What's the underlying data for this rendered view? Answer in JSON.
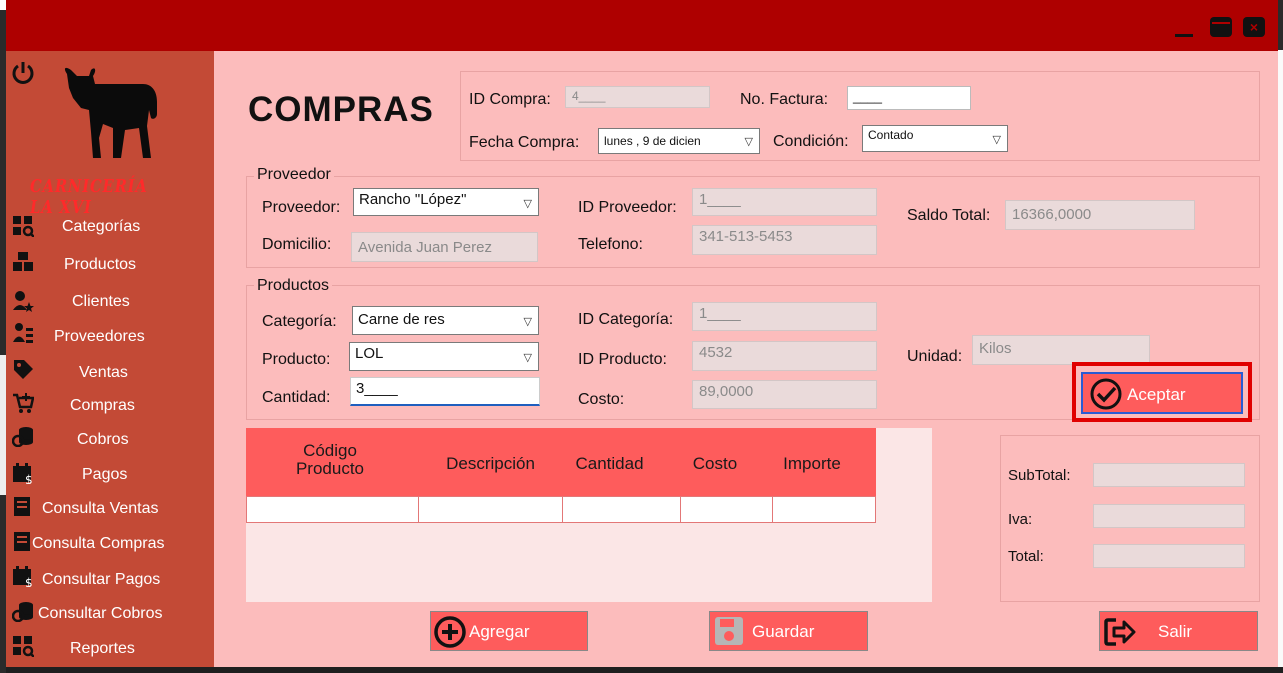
{
  "sidebar": {
    "brand": "CARNICERÍA LA XVI",
    "items": [
      {
        "label": "Categorías",
        "icon": "categories-icon"
      },
      {
        "label": "Productos",
        "icon": "boxes-icon"
      },
      {
        "label": "Clientes",
        "icon": "client-star-icon"
      },
      {
        "label": "Proveedores",
        "icon": "supplier-icon"
      },
      {
        "label": "Ventas",
        "icon": "tag-icon"
      },
      {
        "label": "Compras",
        "icon": "cart-plus-icon"
      },
      {
        "label": "Cobros",
        "icon": "coins-icon"
      },
      {
        "label": "Pagos",
        "icon": "calendar-dollar-icon"
      },
      {
        "label": "Consulta Ventas",
        "icon": "report-icon"
      },
      {
        "label": "Consulta Compras",
        "icon": "report-icon"
      },
      {
        "label": "Consultar Pagos",
        "icon": "calendar-dollar-icon"
      },
      {
        "label": "Consultar Cobros",
        "icon": "coins-icon"
      },
      {
        "label": "Reportes",
        "icon": "categories-icon"
      }
    ]
  },
  "header": {
    "title": "COMPRAS",
    "id_compra_label": "ID Compra:",
    "id_compra_value": "4____",
    "factura_label": "No. Factura:",
    "factura_value": "____",
    "fecha_label": "Fecha Compra:",
    "fecha_value": "lunes  ,  9 de dicien",
    "condicion_label": "Condición:",
    "condicion_value": "Contado"
  },
  "proveedor": {
    "group_title": "Proveedor",
    "proveedor_label": "Proveedor:",
    "proveedor_value": "Rancho \"López\"",
    "domicilio_label": "Domicilio:",
    "domicilio_value": "Avenida Juan Perez",
    "id_label": "ID Proveedor:",
    "id_value": "1____",
    "telefono_label": "Telefono:",
    "telefono_value": "341-513-5453",
    "saldo_label": "Saldo Total:",
    "saldo_value": "16366,0000"
  },
  "productos": {
    "group_title": "Productos",
    "categoria_label": "Categoría:",
    "categoria_value": "Carne de res",
    "producto_label": "Producto:",
    "producto_value": "LOL",
    "cantidad_label": "Cantidad:",
    "cantidad_value": "3____",
    "id_categoria_label": "ID Categoría:",
    "id_categoria_value": "1____",
    "id_producto_label": "ID Producto:",
    "id_producto_value": "4532",
    "costo_label": "Costo:",
    "costo_value": "89,0000",
    "unidad_label": "Unidad:",
    "unidad_value": "Kilos",
    "aceptar_label": "Aceptar"
  },
  "table": {
    "columns": [
      "Código Producto",
      "Descripción",
      "Cantidad",
      "Costo",
      "Importe"
    ]
  },
  "totals": {
    "subtotal_label": "SubTotal:",
    "iva_label": "Iva:",
    "total_label": "Total:"
  },
  "buttons": {
    "agregar": "Agregar",
    "guardar": "Guardar",
    "salir": "Salir"
  },
  "colors": {
    "titlebar": "#ae0000",
    "sidebar": "#c34a36",
    "main": "#fcbcbc",
    "accent_button": "#fe5c5c"
  }
}
